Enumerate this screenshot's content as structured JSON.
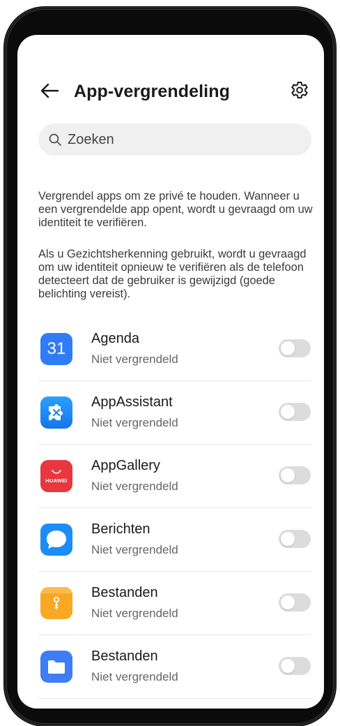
{
  "header": {
    "title": "App-vergrendeling",
    "back_icon": "arrow-left-icon",
    "settings_icon": "gear-icon"
  },
  "search": {
    "placeholder": "Zoeken",
    "icon": "search-icon"
  },
  "description": {
    "paragraph1": "Vergrendel apps om ze privé te houden. Wanneer u een vergrendelde app opent, wordt u gevraagd om uw identiteit te verifiëren.",
    "paragraph2": "Als u Gezichtsherkenning gebruikt, wordt u gevraagd om uw identiteit opnieuw te verifiëren als de telefoon detecteert dat de gebruiker is gewijzigd (goede belichting vereist)."
  },
  "apps": [
    {
      "name": "Agenda",
      "status": "Niet vergrendeld",
      "icon": "calendar-icon",
      "icon_text": "31",
      "locked": false
    },
    {
      "name": "AppAssistant",
      "status": "Niet vergrendeld",
      "icon": "puzzle-icon",
      "locked": false
    },
    {
      "name": "AppGallery",
      "status": "Niet vergrendeld",
      "icon": "huawei-appgallery-icon",
      "icon_text": "HUAWEI",
      "locked": false
    },
    {
      "name": "Berichten",
      "status": "Niet vergrendeld",
      "icon": "message-bubble-icon",
      "locked": false
    },
    {
      "name": "Bestanden",
      "status": "Niet vergrendeld",
      "icon": "file-archive-icon",
      "locked": false
    },
    {
      "name": "Bestanden",
      "status": "Niet vergrendeld",
      "icon": "folder-icon",
      "locked": false
    }
  ],
  "colors": {
    "calendar": "#2f7cf6",
    "appassistant": "#1e8ff5",
    "appgallery": "#e8373f",
    "berichten": "#1d8cf8",
    "bestanden_orange": "#f9a824",
    "bestanden_blue": "#3e7df5",
    "toggle_off": "#dcdcdc"
  }
}
